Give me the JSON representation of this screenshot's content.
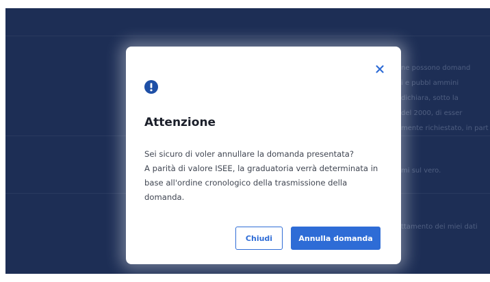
{
  "background": {
    "lines": [
      "ne possono domand",
      "i e pubbl ammini",
      "dichiara, sotto la",
      "del 2000, di esser",
      "mente richiestato, in part",
      "mi sul vero.",
      "ttamento dei miei dati"
    ]
  },
  "dialog": {
    "close_icon": "close-icon",
    "alert_icon": "exclamation-circle-icon",
    "title": "Attenzione",
    "message_line_1": "Sei sicuro di voler annullare la domanda presentata?",
    "message_line_2": "A parità di valore ISEE, la graduatoria verrà determinata in base all'ordine cronologico della trasmissione della domanda.",
    "cancel_label": "Chiudi",
    "confirm_label": "Annulla domanda"
  },
  "colors": {
    "backdrop": "#1d2e55",
    "accent": "#2e6cd6"
  }
}
